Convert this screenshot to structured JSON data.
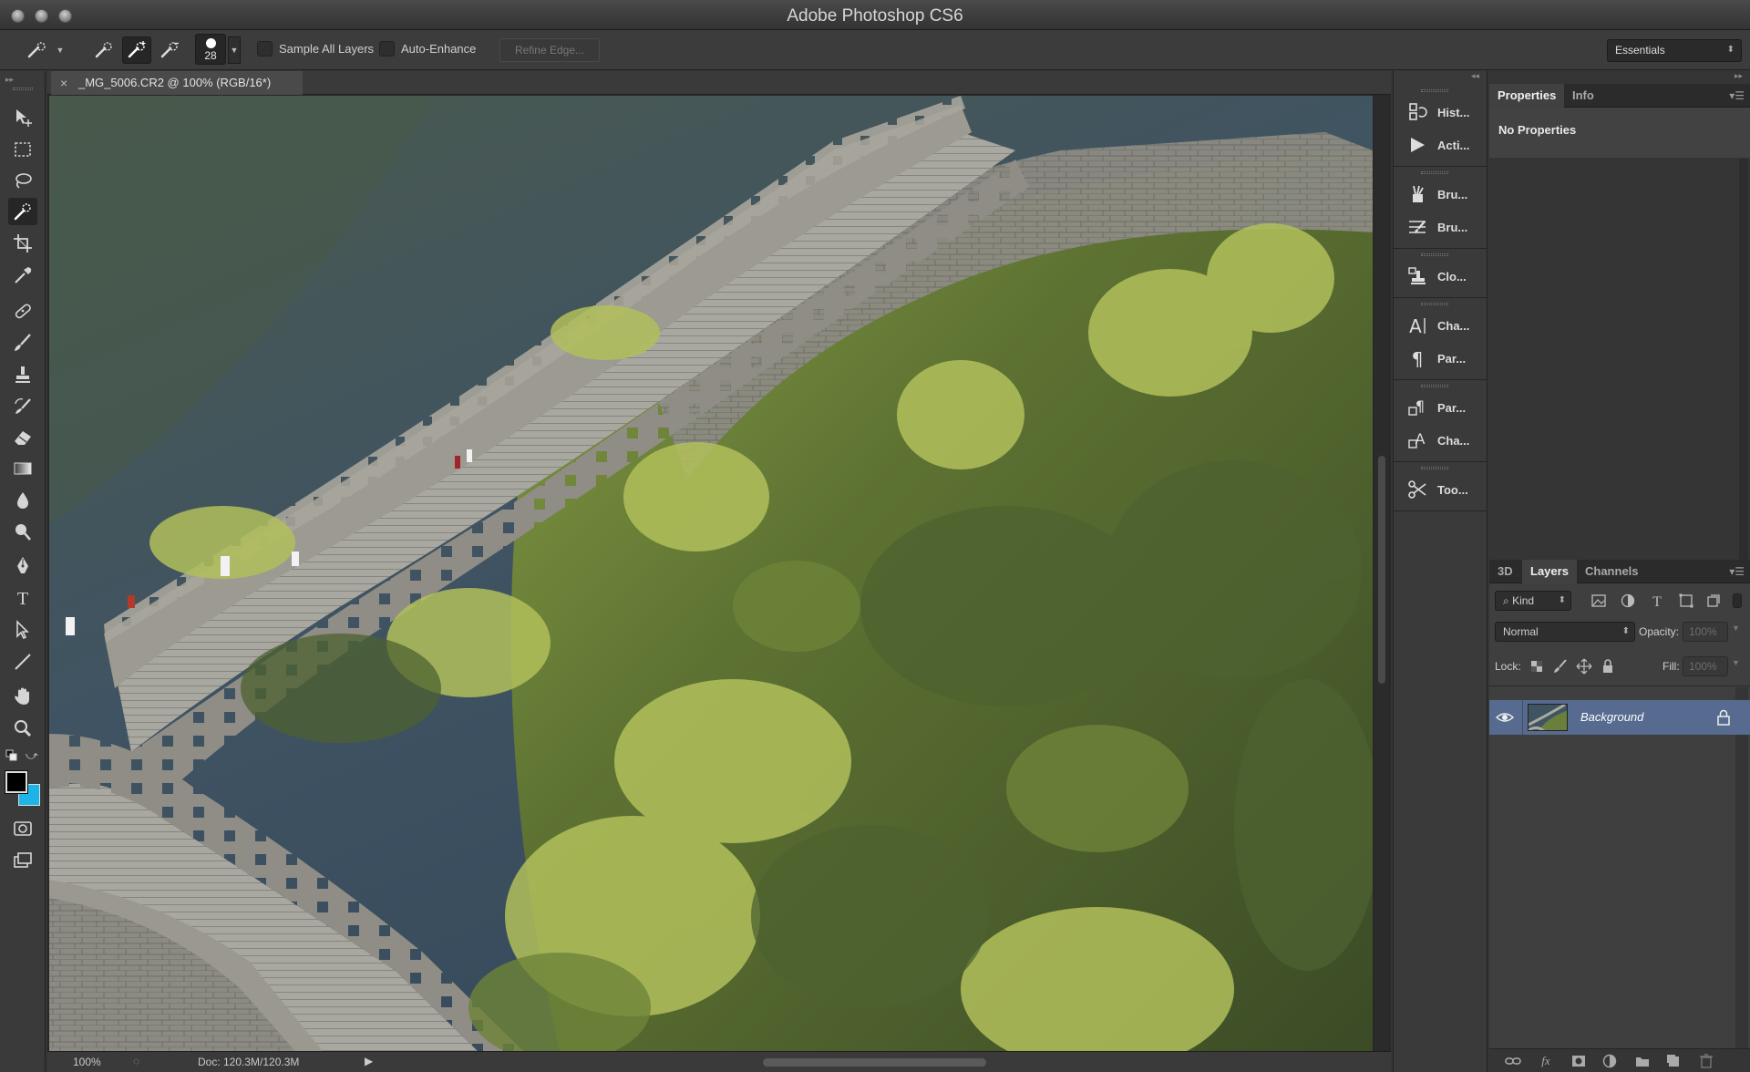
{
  "app": {
    "title": "Adobe Photoshop CS6"
  },
  "options_bar": {
    "brush_size": "28",
    "sample_all_layers_label": "Sample All Layers",
    "sample_all_layers_checked": false,
    "auto_enhance_label": "Auto-Enhance",
    "auto_enhance_checked": false,
    "refine_edge_label": "Refine Edge...",
    "workspace": "Essentials"
  },
  "document": {
    "tab_title": "_MG_5006.CR2 @ 100% (RGB/16*)",
    "close_glyph": "×",
    "zoom": "100%",
    "doc_info": "Doc: 120.3M/120.3M"
  },
  "tools": [
    {
      "name": "move-tool",
      "icon": "move-icon"
    },
    {
      "name": "rectangular-marquee-tool",
      "icon": "marquee-icon"
    },
    {
      "name": "lasso-tool",
      "icon": "lasso-icon"
    },
    {
      "name": "quick-selection-tool",
      "icon": "quick-selection-icon",
      "active": true
    },
    {
      "name": "crop-tool",
      "icon": "crop-icon"
    },
    {
      "name": "eyedropper-tool",
      "icon": "eyedropper-icon"
    },
    {
      "name": "spot-healing-tool",
      "icon": "healing-icon"
    },
    {
      "name": "brush-tool",
      "icon": "brush-icon"
    },
    {
      "name": "clone-stamp-tool",
      "icon": "stamp-icon"
    },
    {
      "name": "history-brush-tool",
      "icon": "history-brush-icon"
    },
    {
      "name": "eraser-tool",
      "icon": "eraser-icon"
    },
    {
      "name": "gradient-tool",
      "icon": "gradient-icon"
    },
    {
      "name": "blur-tool",
      "icon": "blur-drop-icon"
    },
    {
      "name": "dodge-tool",
      "icon": "dodge-icon"
    },
    {
      "name": "pen-tool",
      "icon": "pen-icon"
    },
    {
      "name": "type-tool",
      "icon": "type-icon"
    },
    {
      "name": "path-selection-tool",
      "icon": "path-selection-icon"
    },
    {
      "name": "line-tool",
      "icon": "line-icon"
    },
    {
      "name": "hand-tool",
      "icon": "hand-icon"
    },
    {
      "name": "zoom-tool",
      "icon": "zoom-icon"
    }
  ],
  "colors": {
    "foreground": "#000000",
    "background": "#1eb4e8",
    "layer_selected": "#566b8f"
  },
  "dock": [
    {
      "label": "Hist...",
      "icon": "history-icon"
    },
    {
      "label": "Acti...",
      "icon": "actions-play-icon"
    },
    {
      "label": "Bru...",
      "icon": "brush-presets-icon"
    },
    {
      "label": "Bru...",
      "icon": "brush-settings-icon"
    },
    {
      "label": "Clo...",
      "icon": "clone-source-icon"
    },
    {
      "label": "Cha...",
      "icon": "character-icon"
    },
    {
      "label": "Par...",
      "icon": "paragraph-icon"
    },
    {
      "label": "Par...",
      "icon": "paragraph-styles-icon"
    },
    {
      "label": "Cha...",
      "icon": "character-styles-icon"
    },
    {
      "label": "Too...",
      "icon": "tool-presets-icon"
    }
  ],
  "properties_panel": {
    "tabs": [
      "Properties",
      "Info"
    ],
    "active_tab": "Properties",
    "content": "No Properties"
  },
  "layers_panel": {
    "tabs": [
      "3D",
      "Layers",
      "Channels"
    ],
    "active_tab": "Layers",
    "filter_kind": "Kind",
    "blend_mode": "Normal",
    "opacity_label": "Opacity:",
    "opacity_value": "100%",
    "lock_label": "Lock:",
    "fill_label": "Fill:",
    "fill_value": "100%",
    "layers": [
      {
        "name": "Background",
        "visible": true,
        "locked": true,
        "selected": true
      }
    ]
  }
}
